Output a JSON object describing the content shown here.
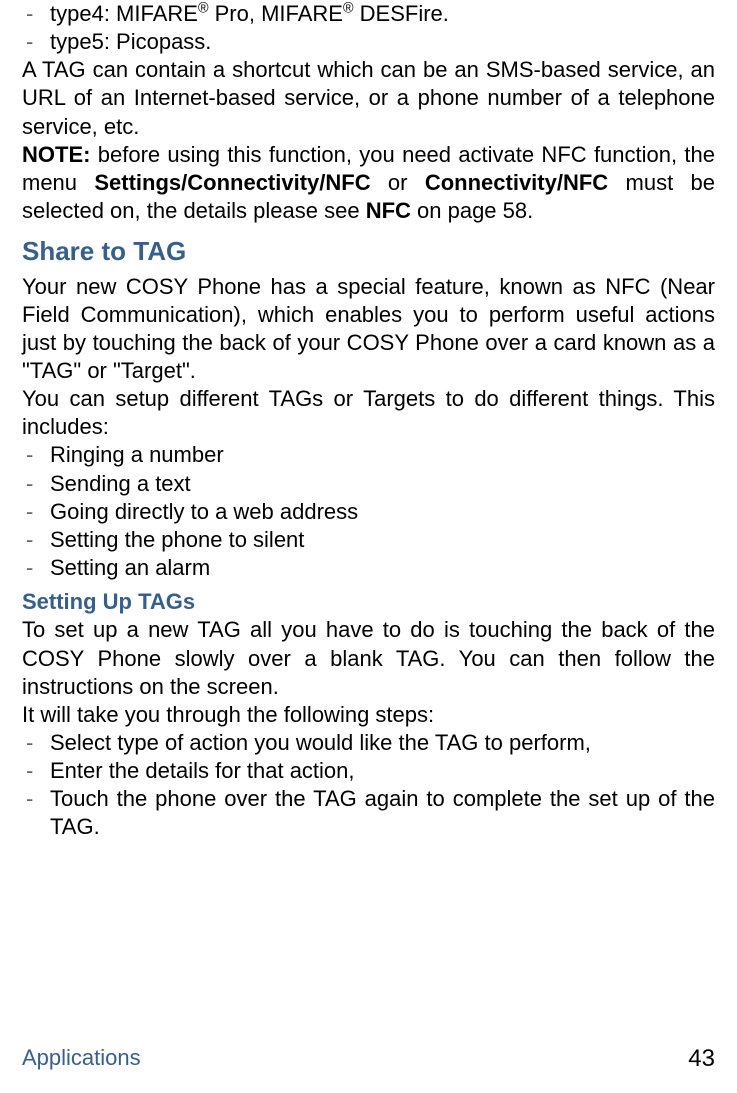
{
  "bullets_top": [
    {
      "pre": "type4: MIFARE",
      "sup1": "®",
      "mid": " Pro, MIFARE",
      "sup2": "®",
      "post": " DESFire."
    },
    {
      "plain": "type5: Picopass."
    }
  ],
  "para1": "A TAG can contain a shortcut which can be an SMS-based service, an URL of an Internet-based service, or a phone number of a telephone service, etc.",
  "note": {
    "lead": "NOTE:",
    "seg1": " before using this function, you need activate NFC function, the menu ",
    "bold1": "Settings/Connectivity/NFC",
    "seg2": " or ",
    "bold2": "Connectivity/NFC",
    "seg3": "  must be selected on, the details please see ",
    "bold3": "NFC",
    "seg4": " on page 58."
  },
  "heading1": "Share to TAG",
  "para2a": "Your new COSY Phone has a special feature, known as NFC (Near Field Communication), which enables you to perform useful actions just by touching the back of your COSY Phone over a card known as a \"TAG\" or \"Target\".",
  "para2b": "You can setup different TAGs or Targets to do different things. This includes:",
  "bullets_mid": [
    "Ringing a number",
    "Sending a text",
    "Going directly to a web address",
    "Setting the phone to silent",
    "Setting an alarm"
  ],
  "subheading": "Setting Up TAGs",
  "para3a": "To set up a new TAG all you have to do is touching the back of the COSY Phone slowly over a blank TAG. You can then follow the instructions on the screen.",
  "para3b": "It will take you through the following steps:",
  "bullets_bot": [
    "Select type of action you would like the TAG to perform,",
    "Enter the details for that action,",
    "Touch the phone over the TAG again to complete the set up of the TAG."
  ],
  "footer": {
    "left": "Applications",
    "right": "43"
  },
  "dash": "-"
}
